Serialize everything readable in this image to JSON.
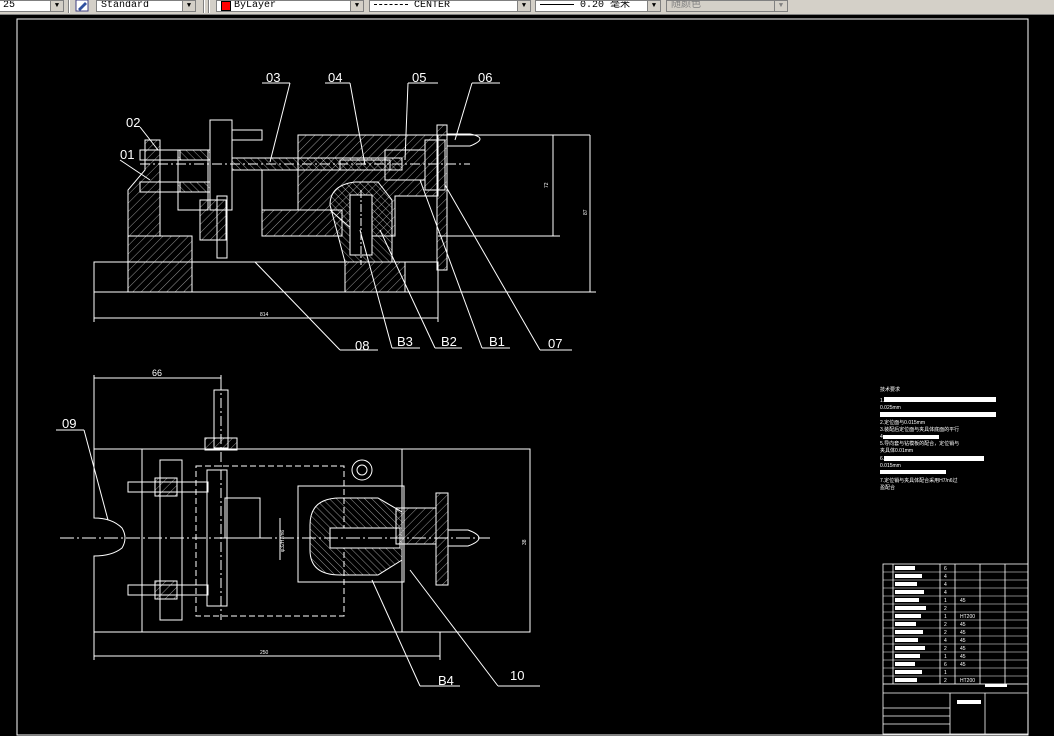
{
  "toolbar": {
    "left_combo_fragment": "25",
    "text_style": "Standard",
    "layer_color": "ByLayer",
    "linetype": "CENTER",
    "lineweight": "0.20 毫米",
    "plot_style": "随颜色"
  },
  "drawing": {
    "balloons": [
      "01",
      "02",
      "03",
      "04",
      "05",
      "06",
      "07",
      "08",
      "B3",
      "B2",
      "B1",
      "09",
      "10",
      "B4"
    ],
    "dims": {
      "front_width": "814",
      "front_height_1": "72",
      "front_height_2": "87",
      "plan_top": "66",
      "plan_width": "250",
      "plan_height": "38",
      "bore": "φ32H7/n6"
    },
    "notes_title": "技术要求",
    "notes": [
      "1.",
      "0.025mm",
      "2.定位面与0.015mm",
      "3.装配后定位面与夹具体底面的平行",
      "4.",
      "5.导向套与钻模板的配合，定位销与",
      "夹具体0.01mm",
      "6.",
      "0.015mm",
      "7.定位销与夹具体配合采用H7/n6过",
      "盈配合"
    ]
  },
  "title_block": {
    "materials": [
      "",
      "",
      "",
      "",
      "45",
      "",
      "HT200",
      "45",
      "45",
      "45",
      "45",
      "45",
      "45",
      "",
      "HT200"
    ],
    "qty": [
      "6",
      "4",
      "4",
      "4",
      "1",
      "2",
      "1",
      "2",
      "2",
      "4",
      "2",
      "1",
      "6",
      "1",
      "2"
    ]
  }
}
